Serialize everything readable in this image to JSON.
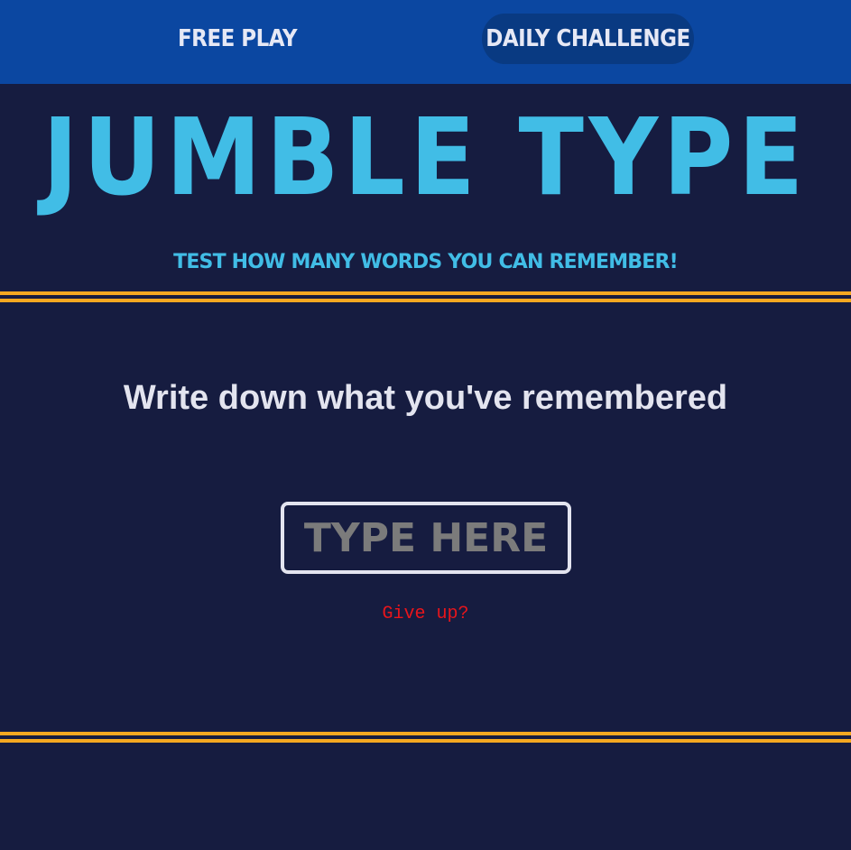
{
  "nav": {
    "free_play": "FREE PLAY",
    "daily_challenge": "DAILY CHALLENGE"
  },
  "header": {
    "title": "JUMBLE TYPE",
    "subtitle": "TEST HOW MANY WORDS YOU CAN REMEMBER!"
  },
  "main": {
    "prompt": "Write down what you've remembered",
    "input_placeholder": "TYPE HERE",
    "input_value": "",
    "give_up": "Give up?"
  },
  "colors": {
    "background": "#161c40",
    "nav_bar": "#0b47a1",
    "active_nav": "#093a82",
    "accent_blue": "#41bde6",
    "divider": "#f5a821",
    "give_up": "#e8151b",
    "text_light": "#e3e4ef"
  }
}
